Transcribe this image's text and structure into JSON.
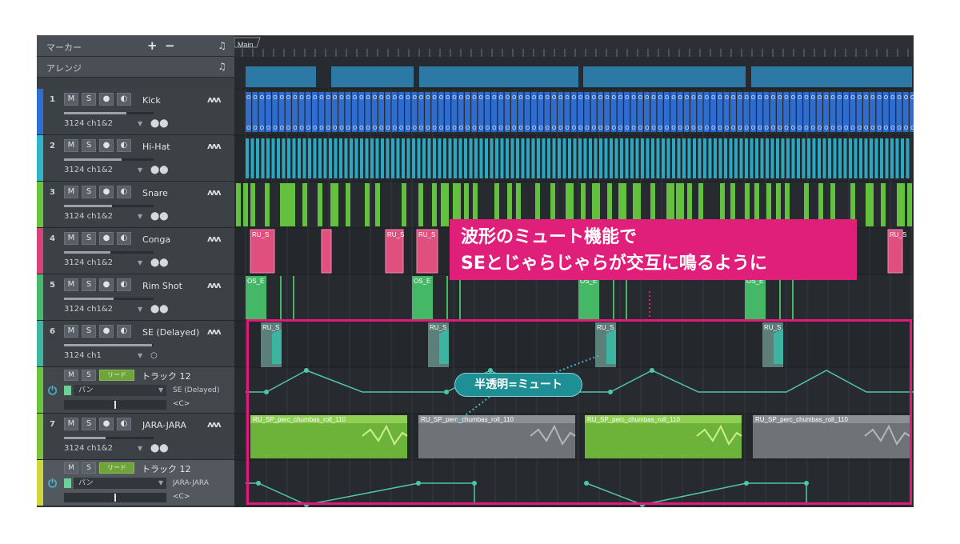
{
  "header": {
    "marker_label": "マーカー",
    "marker_plus": "+",
    "marker_minus": "−",
    "arrange_label": "アレンジ",
    "note_icon": "♫"
  },
  "ruler": {
    "section_label": "Main"
  },
  "buttons": {
    "mute": "M",
    "solo": "S",
    "record": "●",
    "monitor": "◐",
    "read": "リード"
  },
  "tracks": [
    {
      "num": "1",
      "name": "Kick",
      "route": "3124 ch1&2",
      "color": "#2e6fd6",
      "clip_color": "#2f6ccf"
    },
    {
      "num": "2",
      "name": "Hi-Hat",
      "route": "3124 ch1&2",
      "color": "#2fb4c8",
      "clip_color": "#2ca7bf"
    },
    {
      "num": "3",
      "name": "Snare",
      "route": "3124 ch1&2",
      "color": "#6ac43c",
      "clip_color": "#63c13f"
    },
    {
      "num": "4",
      "name": "Conga",
      "route": "3124 ch1&2",
      "color": "#d8447a",
      "clip_color": "#e0507f"
    },
    {
      "num": "5",
      "name": "Rim Shot",
      "route": "3124 ch1&2",
      "color": "#46b96a",
      "clip_color": "#45b868"
    },
    {
      "num": "6",
      "name": "SE (Delayed)",
      "route": "3124 ch1",
      "color": "#3fb5a3",
      "clip_color": "#3db3a1"
    },
    {
      "num": "7",
      "name": "JARA-JARA",
      "route": "3124 ch1&2",
      "color": "#7fc13a",
      "clip_color": "#6db33a"
    }
  ],
  "automation": [
    {
      "name": "トラック 12",
      "param": "パン",
      "target": "SE (Delayed)",
      "value": "<C>"
    },
    {
      "name": "トラック 12",
      "param": "パン",
      "target": "JARA-JARA",
      "value": "<C>"
    }
  ],
  "clips": {
    "conga": "RU_S",
    "rim": "OS_E",
    "se": "RU_S",
    "jara": "RU_SP_perc_chumbas_roll_110"
  },
  "callout": {
    "line1": "波形のミュート機能で",
    "line2": "SEとじゃらじゃらが交互に鳴るように"
  },
  "pill_label": "半透明=ミュート",
  "colors": {
    "accent": "#e2197a",
    "pill": "#1f8f96",
    "automation": "#4fc6a8"
  }
}
